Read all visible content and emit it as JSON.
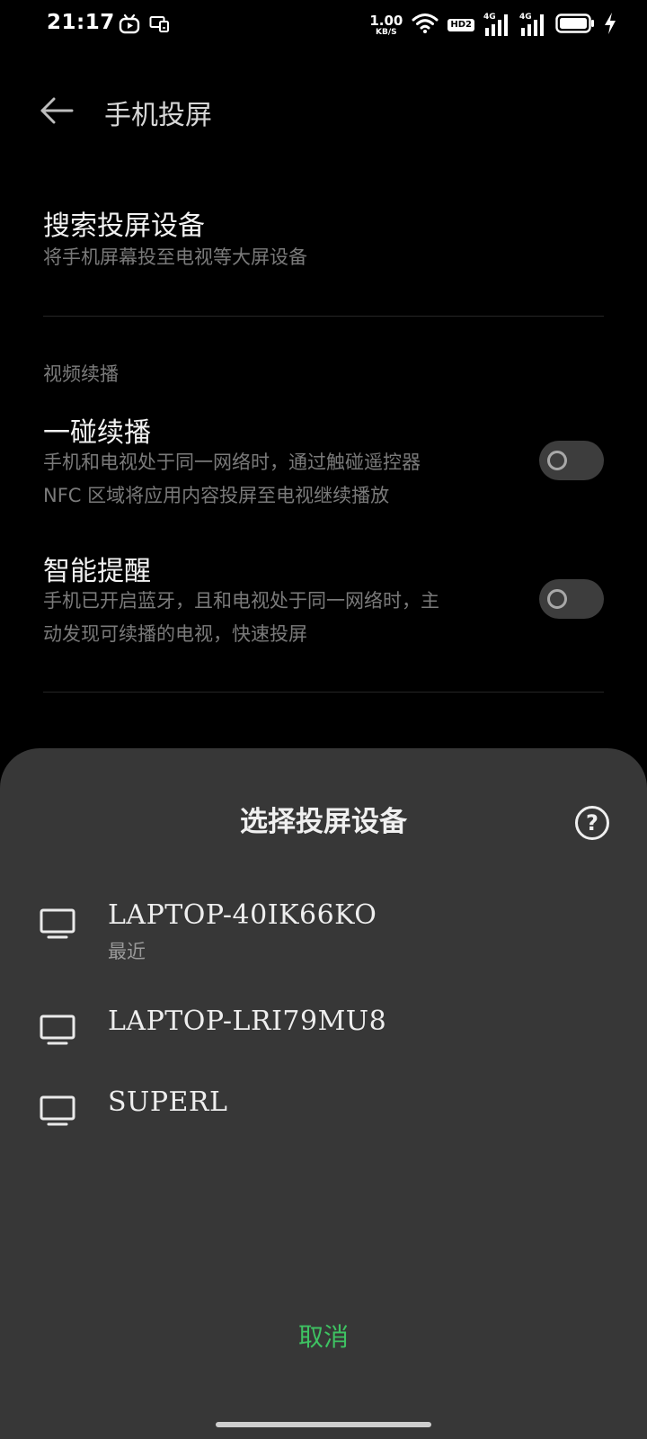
{
  "status_bar": {
    "time": "21:17",
    "net_speed": "1.00",
    "net_speed_unit": "KB/S",
    "hd_badge": "HD2",
    "sim1_label": "4G",
    "sim2_label": "4G",
    "icons": [
      "bilibili-icon",
      "screen-cast-icon",
      "wifi-icon",
      "hd-volte-icon",
      "signal-icon",
      "battery-icon",
      "charging-icon"
    ]
  },
  "header": {
    "title": "手机投屏"
  },
  "search_cast": {
    "title": "搜索投屏设备",
    "description": "将手机屏幕投至电视等大屏设备"
  },
  "video_continue": {
    "section_label": "视频续播",
    "tap_continue": {
      "title": "一碰续播",
      "description_line1": "手机和电视处于同一网络时，通过触碰遥控器",
      "description_line2": "NFC 区域将应用内容投屏至电视继续播放",
      "enabled": false
    },
    "smart_reminder": {
      "title": "智能提醒",
      "description_line1": "手机已开启蓝牙，且和电视处于同一网络时，主",
      "description_line2": "动发现可续播的电视，快速投屏",
      "enabled": false
    }
  },
  "sheet": {
    "title": "选择投屏设备",
    "help_glyph": "?",
    "devices": [
      {
        "name": "LAPTOP-40IK66KO",
        "subtitle": "最近"
      },
      {
        "name": "LAPTOP-LRI79MU8",
        "subtitle": ""
      },
      {
        "name": "SUPERL",
        "subtitle": ""
      }
    ],
    "cancel_label": "取消"
  },
  "colors": {
    "background": "#000000",
    "sheet_background": "#373737",
    "accent_green": "#3ec262",
    "secondary_text": "#7a7a7a"
  }
}
